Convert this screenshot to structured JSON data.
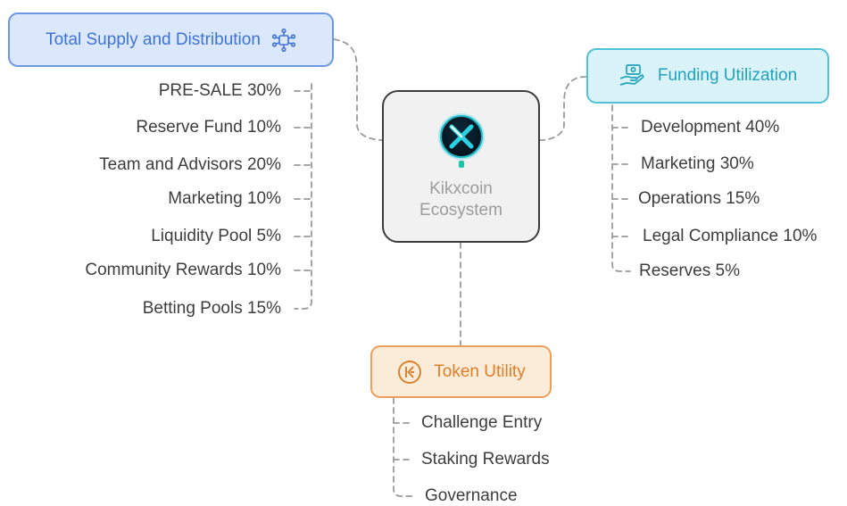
{
  "center": {
    "label": "Kikxcoin\nEcosystem",
    "logo_icon": "kikxcoin-x-logo-icon"
  },
  "supply": {
    "title": "Total Supply and Distribution",
    "icon": "network-nodes-icon",
    "accent": "#3f73d6",
    "items": [
      "PRE-SALE 30%",
      "Reserve Fund 10%",
      "Team and Advisors 20%",
      "Marketing 10%",
      "Liquidity Pool 5%",
      "Community Rewards 10%",
      "Betting Pools 15%"
    ]
  },
  "funding": {
    "title": "Funding Utilization",
    "icon": "hand-holding-money-icon",
    "accent": "#22a2bd",
    "items": [
      "Development 40%",
      "Marketing 30%",
      "Operations 15%",
      "Legal Compliance 10%",
      "Reserves 5%"
    ]
  },
  "utility": {
    "title": "Token Utility",
    "icon": "token-coin-icon",
    "accent": "#dd7f27",
    "items": [
      "Challenge Entry",
      "Staking Rewards",
      "Governance"
    ]
  }
}
